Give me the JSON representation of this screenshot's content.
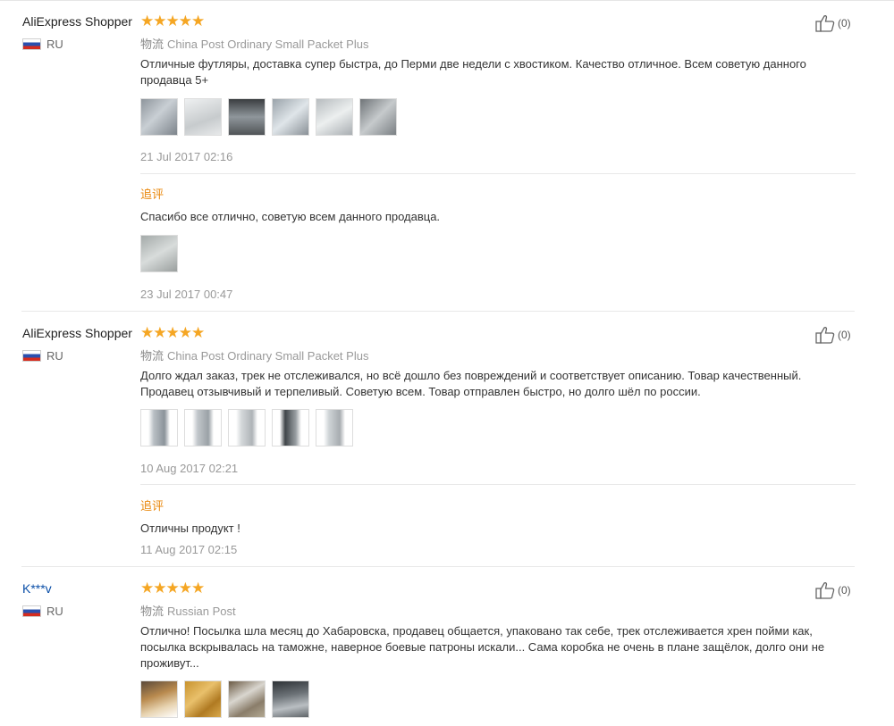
{
  "reviews": [
    {
      "user": "AliExpress Shopper",
      "country": "RU",
      "stars": "★★★★★",
      "logistics_label": "物流",
      "logistics": "China Post Ordinary Small Packet Plus",
      "text": "Отличные футляры, доставка супер быстра, до Перми две недели с хвостиком. Качество отличное. Всем советую данного продавца 5+",
      "date": "21 Jul 2017 02:16",
      "likes": "(0)",
      "followup": {
        "label": "追评",
        "text": "Спасибо все отлично, советую всем данного продавца.",
        "date": "23 Jul 2017 00:47"
      }
    },
    {
      "user": "AliExpress Shopper",
      "country": "RU",
      "stars": "★★★★★",
      "logistics_label": "物流",
      "logistics": "China Post Ordinary Small Packet Plus",
      "text": "Долго ждал заказ, трек не отслеживался, но всё дошло без повреждений и соответствует описанию. Товар качественный. Продавец отзывчивый и терпеливый. Советую всем. Товар отправлен быстро, но долго шёл по россии.",
      "date": "10 Aug 2017 02:21",
      "likes": "(0)",
      "followup": {
        "label": "追评",
        "text": "Отличны продукт !",
        "date": "11 Aug 2017 02:15"
      }
    },
    {
      "user": "K***v",
      "country": "RU",
      "stars": "★★★★★",
      "logistics_label": "物流",
      "logistics": "Russian Post",
      "text": "Отлично! Посылка шла месяц до Хабаровска, продавец общается, упаковано так себе, трек отслеживается хрен пойми как, посылка вскрывалась на таможне, наверное боевые патроны искали... Сама коробка не очень в плане защёлок, долго они не проживут...",
      "likes": "(0)"
    }
  ],
  "colors": {
    "star": "#f5a623",
    "followup_label": "#e9870b",
    "username_link": "#0b4fa8"
  }
}
